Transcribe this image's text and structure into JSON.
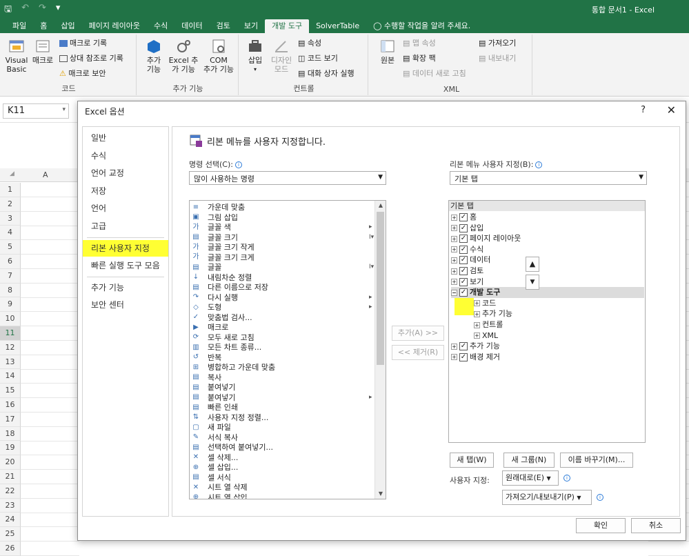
{
  "titlebar": {
    "qat": [
      "save-icon",
      "undo-icon",
      "redo-icon",
      "customize-icon"
    ],
    "title": "통합 문서1 - Excel"
  },
  "tabs": [
    "파일",
    "홈",
    "삽입",
    "페이지 레이아웃",
    "수식",
    "데이터",
    "검토",
    "보기",
    "개발 도구",
    "SolverTable",
    "수행할 작업을 알려 주세요."
  ],
  "active_tab": "개발 도구",
  "ribbon": {
    "code": {
      "name": "코드",
      "vb": "Visual\nBasic",
      "macro": "매크로",
      "record": "매크로 기록",
      "relative": "상대 참조로 기록",
      "security": "매크로 보안"
    },
    "addins": {
      "name": "추가 기능",
      "add": "추가\n기능",
      "excel": "Excel 추\n가 기능",
      "com": "COM\n추가 기능"
    },
    "controls": {
      "name": "컨트롤",
      "insert": "삽입",
      "design": "디자인\n모드",
      "props": "속성",
      "viewcode": "코드 보기",
      "dialog": "대화 상자 실행"
    },
    "xml": {
      "name": "XML",
      "source": "원본",
      "mapprops": "맵 속성",
      "expand": "확장 팩",
      "refresh": "데이터 새로 고침",
      "import": "가져오기",
      "export": "내보내기"
    }
  },
  "namebox": "K11",
  "sheet": {
    "col_a": "A",
    "rows": [
      "1",
      "2",
      "3",
      "4",
      "5",
      "6",
      "7",
      "8",
      "9",
      "10",
      "11",
      "12",
      "13",
      "14",
      "15",
      "16",
      "17",
      "18",
      "19",
      "20",
      "21",
      "22",
      "23",
      "24",
      "25",
      "26"
    ],
    "selected_row": "11"
  },
  "dialog": {
    "title": "Excel 옵션",
    "help": "?",
    "close": "✕",
    "nav": [
      "일반",
      "수식",
      "언어 교정",
      "저장",
      "언어",
      "고급",
      "리본 사용자 지정",
      "빠른 실행 도구 모음",
      "추가 기능",
      "보안 센터"
    ],
    "selected_nav": "리본 사용자 지정",
    "heading": "리본 메뉴를 사용자 지정합니다.",
    "choose_label": "명령 선택(C):",
    "choose_value": "많이 사용하는 명령",
    "customize_label": "리본 메뉴 사용자 지정(B):",
    "customize_value": "기본 탭",
    "commands": [
      "가운데 맞춤",
      "그림 삽입",
      "글꼴 색",
      "글꼴 크기",
      "글꼴 크기 작게",
      "글꼴 크기 크게",
      "글꼴",
      "내림차순 정렬",
      "다른 이름으로 저장",
      "다시 실행",
      "도형",
      "맞춤법 검사...",
      "매크로",
      "모두 새로 고침",
      "모든 차트 종류...",
      "반복",
      "병합하고 가운데 맞춤",
      "복사",
      "붙여넣기",
      "붙여넣기",
      "빠른 인쇄",
      "사용자 지정 정렬...",
      "새 파일",
      "서식 복사",
      "선택하여 붙여넣기...",
      "셀 삭제...",
      "셀 삽입...",
      "셀 서식",
      "시트 열 삭제",
      "시트 열 삽입"
    ],
    "add_button": "추가(A) >>",
    "remove_button": "<< 제거(R)",
    "tree_header": "기본 탭",
    "tree": [
      {
        "label": "홈",
        "level": 0
      },
      {
        "label": "삽입",
        "level": 0
      },
      {
        "label": "페이지 레이아웃",
        "level": 0
      },
      {
        "label": "수식",
        "level": 0
      },
      {
        "label": "데이터",
        "level": 0
      },
      {
        "label": "검토",
        "level": 0
      },
      {
        "label": "보기",
        "level": 0
      },
      {
        "label": "개발 도구",
        "level": 0
      },
      {
        "label": "코드",
        "level": 1
      },
      {
        "label": "추가 기능",
        "level": 1
      },
      {
        "label": "컨트롤",
        "level": 1
      },
      {
        "label": "XML",
        "level": 1
      },
      {
        "label": "추가 기능",
        "level": 0
      },
      {
        "label": "배경 제거",
        "level": 0
      }
    ],
    "new_tab": "새 탭(W)",
    "new_group": "새 그룹(N)",
    "rename": "이름 바꾸기(M)...",
    "customize_text": "사용자 지정:",
    "reset": "원래대로(E)",
    "import_export": "가져오기/내보내기(P)",
    "ok": "확인",
    "cancel": "취소"
  },
  "colors": {
    "accent": "#217346",
    "highlight": "#ffff33"
  }
}
